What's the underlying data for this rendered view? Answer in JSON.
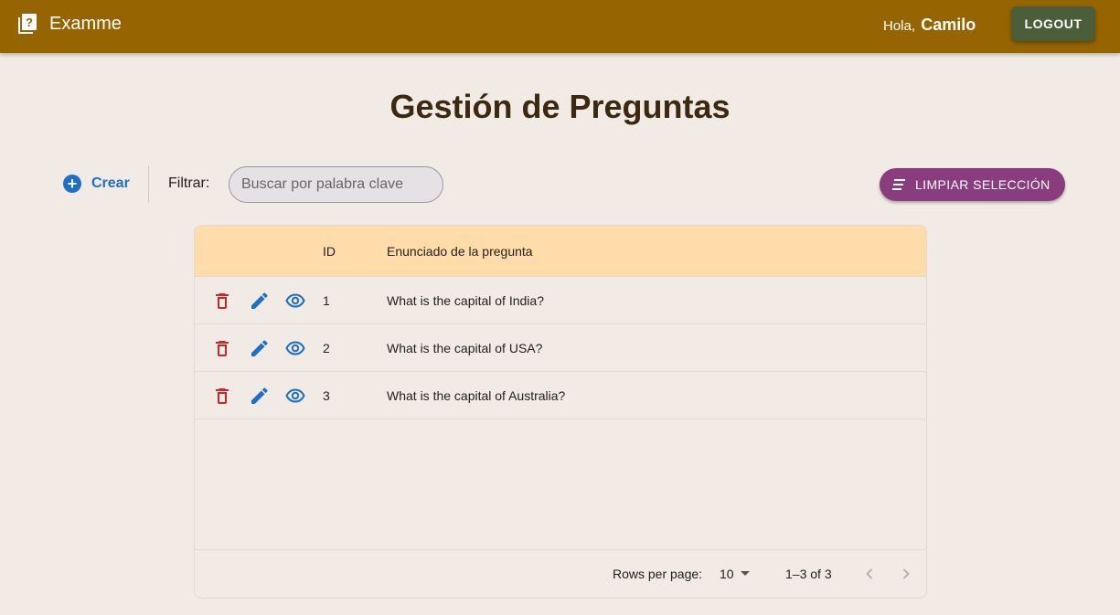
{
  "app": {
    "title": "Examme"
  },
  "header": {
    "greeting": "Hola,",
    "user": "Camilo",
    "logout_label": "LOGOUT"
  },
  "page": {
    "title": "Gestión de Preguntas"
  },
  "toolbar": {
    "create_label": "Crear",
    "filter_label": "Filtrar:",
    "search_placeholder": "Buscar por palabra clave",
    "clear_label": "LIMPIAR SELECCIÓN"
  },
  "table": {
    "columns": {
      "id": "ID",
      "statement": "Enunciado de la pregunta"
    },
    "rows": [
      {
        "id": "1",
        "statement": "What is the capital of India?"
      },
      {
        "id": "2",
        "statement": "What is the capital of USA?"
      },
      {
        "id": "3",
        "statement": "What is the capital of Australia?"
      }
    ],
    "footer": {
      "rows_per_page_label": "Rows per page:",
      "rows_per_page_value": "10",
      "range": "1–3 of 3"
    }
  },
  "colors": {
    "appbar": "#966400",
    "logout": "#4b5e3a",
    "primary": "#1f6fc5",
    "clear_button": "#8a3d7e",
    "delete": "#c62828",
    "header_row": "#ffdcaa"
  },
  "icons": [
    "quiz-icon",
    "add-circle-icon",
    "sort-icon",
    "delete-icon",
    "edit-icon",
    "view-icon",
    "chevron-left-icon",
    "chevron-right-icon",
    "dropdown-arrow-icon"
  ]
}
